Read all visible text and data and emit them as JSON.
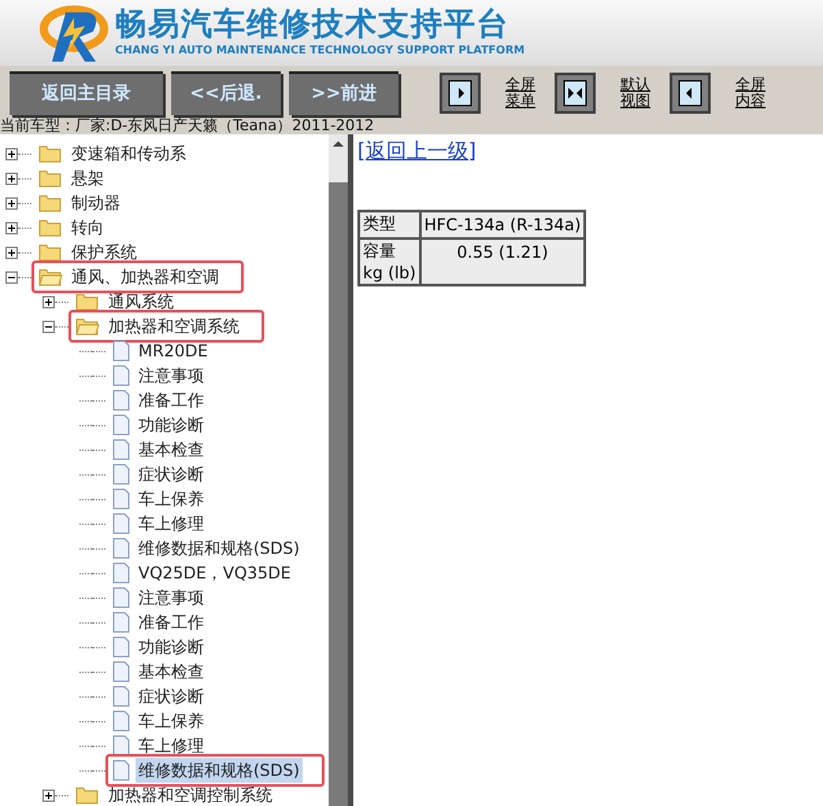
{
  "header": {
    "title": "畅易汽车维修技术支持平台",
    "subtitle": "CHANG YI AUTO MAINTENANCE TECHNOLOGY SUPPORT PLATFORM"
  },
  "nav_buttons": [
    "返回主目录",
    "<<后退.",
    ">>前进"
  ],
  "view_buttons": [
    {
      "kind": "menu",
      "line1": "全屏",
      "line2": "菜单"
    },
    {
      "kind": "default",
      "line1": "默认",
      "line2": "视图"
    },
    {
      "kind": "content",
      "line1": "全屏",
      "line2": "内容"
    }
  ],
  "current_model": "当前车型：厂家:D-东风日产天籁（Teana）2011-2012",
  "tree": [
    {
      "label": "变速箱和传动系",
      "kind": "folder",
      "expanded": false,
      "highlighted": false,
      "selected": false
    },
    {
      "label": "悬架",
      "kind": "folder",
      "expanded": false,
      "highlighted": false,
      "selected": false
    },
    {
      "label": "制动器",
      "kind": "folder",
      "expanded": false,
      "highlighted": false,
      "selected": false
    },
    {
      "label": "转向",
      "kind": "folder",
      "expanded": false,
      "highlighted": false,
      "selected": false
    },
    {
      "label": "保护系统",
      "kind": "folder",
      "expanded": false,
      "highlighted": false,
      "selected": false
    },
    {
      "label": "通风、加热器和空调",
      "kind": "folder",
      "expanded": true,
      "highlighted": true,
      "selected": false,
      "children": [
        {
          "label": "通风系统",
          "kind": "folder",
          "expanded": false,
          "highlighted": false,
          "selected": false
        },
        {
          "label": "加热器和空调系统",
          "kind": "folder",
          "expanded": true,
          "highlighted": true,
          "selected": false,
          "children": [
            {
              "label": "MR20DE",
              "kind": "page",
              "highlighted": false,
              "selected": false
            },
            {
              "label": "注意事项",
              "kind": "page",
              "highlighted": false,
              "selected": false
            },
            {
              "label": "准备工作",
              "kind": "page",
              "highlighted": false,
              "selected": false
            },
            {
              "label": "功能诊断",
              "kind": "page",
              "highlighted": false,
              "selected": false
            },
            {
              "label": "基本检查",
              "kind": "page",
              "highlighted": false,
              "selected": false
            },
            {
              "label": "症状诊断",
              "kind": "page",
              "highlighted": false,
              "selected": false
            },
            {
              "label": "车上保养",
              "kind": "page",
              "highlighted": false,
              "selected": false
            },
            {
              "label": "车上修理",
              "kind": "page",
              "highlighted": false,
              "selected": false
            },
            {
              "label": "维修数据和规格(SDS)",
              "kind": "page",
              "highlighted": false,
              "selected": false
            },
            {
              "label": "VQ25DE，VQ35DE",
              "kind": "page",
              "highlighted": false,
              "selected": false
            },
            {
              "label": "注意事项",
              "kind": "page",
              "highlighted": false,
              "selected": false
            },
            {
              "label": "准备工作",
              "kind": "page",
              "highlighted": false,
              "selected": false
            },
            {
              "label": "功能诊断",
              "kind": "page",
              "highlighted": false,
              "selected": false
            },
            {
              "label": "基本检查",
              "kind": "page",
              "highlighted": false,
              "selected": false
            },
            {
              "label": "症状诊断",
              "kind": "page",
              "highlighted": false,
              "selected": false
            },
            {
              "label": "车上保养",
              "kind": "page",
              "highlighted": false,
              "selected": false
            },
            {
              "label": "车上修理",
              "kind": "page",
              "highlighted": false,
              "selected": false
            },
            {
              "label": "维修数据和规格(SDS)",
              "kind": "page",
              "highlighted": true,
              "selected": true
            }
          ]
        },
        {
          "label": "加热器和空调控制系统",
          "kind": "folder",
          "expanded": false,
          "highlighted": false,
          "selected": false
        }
      ]
    }
  ],
  "back_link": "[返回上一级]",
  "spec_table": [
    {
      "label": "类型",
      "value": "HFC-134a (R-134a)"
    },
    {
      "label": "容量",
      "unit": "kg (lb)",
      "value": "0.55 (1.21)"
    }
  ]
}
